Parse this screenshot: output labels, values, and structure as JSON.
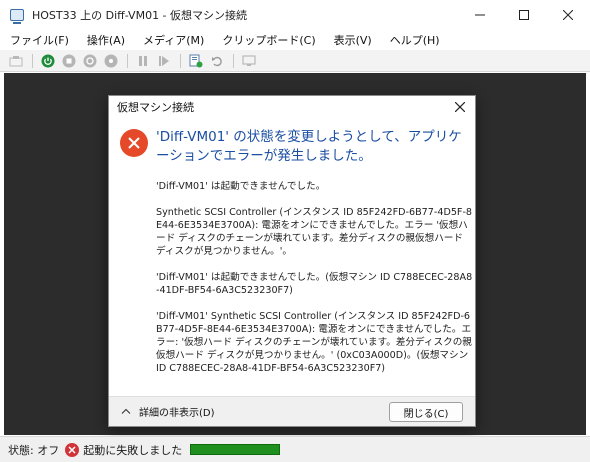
{
  "window": {
    "title": "HOST33 上の Diff-VM01 - 仮想マシン接続"
  },
  "menu": [
    "ファイル(F)",
    "操作(A)",
    "メディア(M)",
    "クリップボード(C)",
    "表示(V)",
    "ヘルプ(H)"
  ],
  "toolbar": {
    "icons": [
      "ctrl-alt-del-icon",
      "start-icon",
      "turn-off-icon",
      "shut-down-icon",
      "save-icon",
      "pause-icon",
      "reset-icon",
      "checkpoint-icon",
      "revert-icon",
      "enhanced-session-icon"
    ]
  },
  "dialog": {
    "title": "仮想マシン接続",
    "heading": "'Diff-VM01' の状態を変更しようとして、アプリケーションでエラーが発生しました。",
    "paragraphs": [
      "'Diff-VM01' は起動できませんでした。",
      "Synthetic SCSI Controller (インスタンス ID 85F242FD-6B77-4D5F-8E44-6E3534E3700A): 電源をオンにできませんでした。エラー '仮想ハード ディスクのチェーンが壊れています。差分ディスクの親仮想ハード ディスクが見つかりません。'。",
      "'Diff-VM01' は起動できませんでした。(仮想マシン ID C788ECEC-28A8-41DF-BF54-6A3C523230F7)",
      "'Diff-VM01' Synthetic SCSI Controller (インスタンス ID 85F242FD-6B77-4D5F-8E44-6E3534E3700A): 電源をオンにできませんでした。エラー: '仮想ハード ディスクのチェーンが壊れています。差分ディスクの親仮想ハード ディスクが見つかりません。' (0xC03A000D)。(仮想マシン ID C788ECEC-28A8-41DF-BF54-6A3C523230F7)"
    ],
    "details_toggle": "詳細の非表示(D)",
    "close_button": "閉じる(C)"
  },
  "status": {
    "state": "状態: オフ",
    "message": "起動に失敗しました"
  },
  "colors": {
    "heading": "#1b4ea3",
    "error_icon": "#e5492a",
    "progress": "#1f8f1f",
    "vm_background": "#2c2c2c"
  }
}
